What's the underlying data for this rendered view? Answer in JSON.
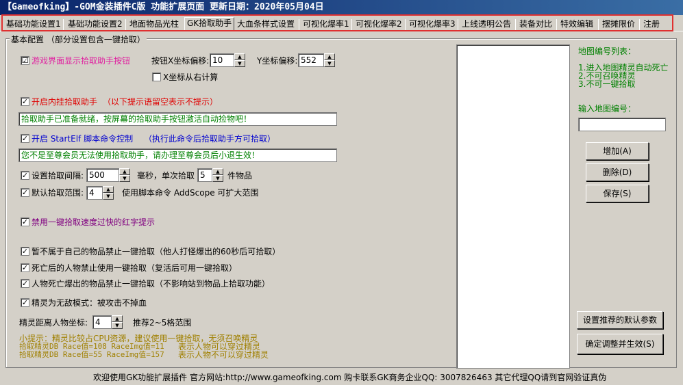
{
  "window": {
    "title": "【Gameofking】-GOM金装插件C版 功能扩展页面      更新日期：2020年05月04日"
  },
  "tabs": [
    "基础功能设置1",
    "基础功能设置2",
    "地面物品光柱",
    "GK拾取助手",
    "大血条样式设置",
    "可视化爆率1",
    "可视化爆率2",
    "可视化爆率3",
    "上线透明公告",
    "装备对比",
    "特效编辑",
    "摆摊限价",
    "注册"
  ],
  "group_title": "基本配置 （部分设置包含一键拾取）",
  "opt_show_button": {
    "label": "游戏界面显示拾取助手按钮",
    "checked": "☑"
  },
  "btn_x_offset": {
    "label": "按钮X坐标偏移:",
    "value": "10"
  },
  "y_offset": {
    "label": "Y坐标偏移:",
    "value": "552"
  },
  "x_from_right": {
    "label": "X坐标从右计算",
    "checked": ""
  },
  "opt_hang": {
    "label": "开启内挂拾取助手",
    "hint": "（以下提示语留空表示不提示）",
    "message": "拾取助手已准备就绪，按屏幕的拾取助手按钮激活自动捡物吧！"
  },
  "opt_script": {
    "label": "开启 StartElf 脚本命令控制",
    "hint": "（执行此命令后拾取助手方可拾取）",
    "message": "您不是至尊会员无法使用拾取助手，请办理至尊会员后小退生效！"
  },
  "interval": {
    "label": "设置拾取间隔:",
    "value": "500",
    "unit": "毫秒，单次拾取",
    "count": "5",
    "count_unit": "件物品"
  },
  "range": {
    "label": "默认拾取范围:",
    "value": "4",
    "hint": "使用脚本命令 AddScope 可扩大范围"
  },
  "opt_disable_tip": {
    "label": "禁用一键拾取速度过快的红字提示"
  },
  "opt_not_own": {
    "label": "暂不属于自己的物品禁止一键拾取（他人打怪爆出的60秒后可拾取）"
  },
  "opt_dead": {
    "label": "死亡后的人物禁止使用一键拾取（复活后可用一键拾取）"
  },
  "opt_death_drop": {
    "label": "人物死亡爆出的物品禁止一键拾取（不影响站到物品上拾取功能）"
  },
  "opt_invincible": {
    "label": "精灵为无敌模式：被攻击不掉血"
  },
  "distance": {
    "label": "精灵距离人物坐标:",
    "value": "4",
    "hint": "推荐2~5格范围"
  },
  "tips": {
    "line1": "小提示：精灵比较占CPU资源，建议使用一键拾取，无须召唤精灵",
    "line2a": "拾取精灵DB Race值=108 RaceImg值=11",
    "line2b": "表示人物可以穿过精灵",
    "line3a": "拾取精灵DB Race值=55  RaceImg值=157",
    "line3b": "表示人物不可以穿过精灵"
  },
  "map_panel": {
    "list_title": "地图编号列表：",
    "notes": [
      "1.进入地图精灵自动死亡",
      "2.不可召唤精灵",
      "3.不可一键拾取"
    ],
    "input_label": "输入地图编号：",
    "add": "增加(A)",
    "delete": "删除(D)",
    "save": "保存(S)",
    "recommend": "设置推荐的默认参数",
    "apply": "确定调整并生效(S)"
  },
  "status": "欢迎使用GK功能扩展插件   官方网站:http://www.gameofking.com   购卡联系GK商务企业QQ: 3007826463   其它代理QQ请到官网验证真伪"
}
